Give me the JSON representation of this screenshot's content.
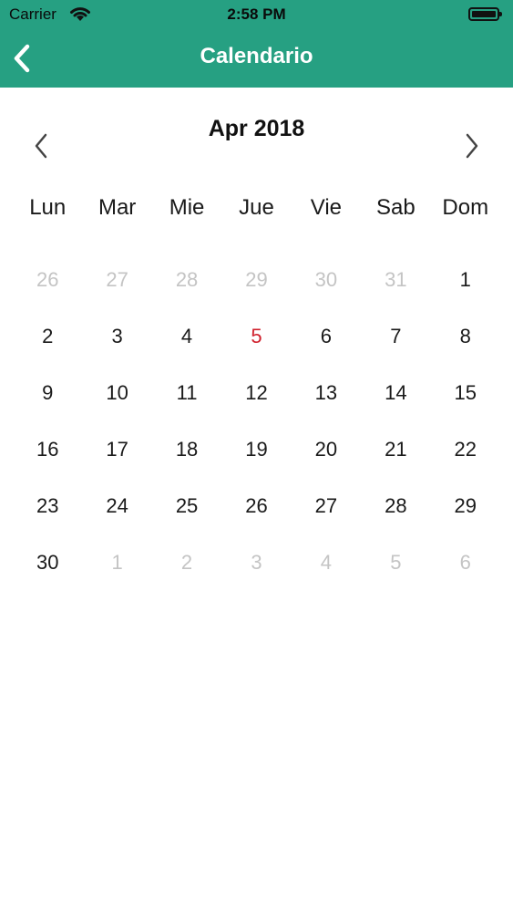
{
  "status_bar": {
    "carrier": "Carrier",
    "time": "2:58 PM"
  },
  "nav": {
    "title": "Calendario"
  },
  "calendar": {
    "month_label": "Apr 2018",
    "weekdays": [
      "Lun",
      "Mar",
      "Mie",
      "Jue",
      "Vie",
      "Sab",
      "Dom"
    ],
    "weeks": [
      [
        {
          "d": "26",
          "in": false
        },
        {
          "d": "27",
          "in": false
        },
        {
          "d": "28",
          "in": false
        },
        {
          "d": "29",
          "in": false
        },
        {
          "d": "30",
          "in": false
        },
        {
          "d": "31",
          "in": false
        },
        {
          "d": "1",
          "in": true
        }
      ],
      [
        {
          "d": "2",
          "in": true
        },
        {
          "d": "3",
          "in": true
        },
        {
          "d": "4",
          "in": true
        },
        {
          "d": "5",
          "in": true,
          "today": true
        },
        {
          "d": "6",
          "in": true
        },
        {
          "d": "7",
          "in": true
        },
        {
          "d": "8",
          "in": true
        }
      ],
      [
        {
          "d": "9",
          "in": true
        },
        {
          "d": "10",
          "in": true
        },
        {
          "d": "11",
          "in": true
        },
        {
          "d": "12",
          "in": true
        },
        {
          "d": "13",
          "in": true
        },
        {
          "d": "14",
          "in": true
        },
        {
          "d": "15",
          "in": true
        }
      ],
      [
        {
          "d": "16",
          "in": true
        },
        {
          "d": "17",
          "in": true
        },
        {
          "d": "18",
          "in": true
        },
        {
          "d": "19",
          "in": true
        },
        {
          "d": "20",
          "in": true
        },
        {
          "d": "21",
          "in": true
        },
        {
          "d": "22",
          "in": true
        }
      ],
      [
        {
          "d": "23",
          "in": true
        },
        {
          "d": "24",
          "in": true
        },
        {
          "d": "25",
          "in": true
        },
        {
          "d": "26",
          "in": true
        },
        {
          "d": "27",
          "in": true
        },
        {
          "d": "28",
          "in": true
        },
        {
          "d": "29",
          "in": true
        }
      ],
      [
        {
          "d": "30",
          "in": true
        },
        {
          "d": "1",
          "in": false
        },
        {
          "d": "2",
          "in": false
        },
        {
          "d": "3",
          "in": false
        },
        {
          "d": "4",
          "in": false
        },
        {
          "d": "5",
          "in": false
        },
        {
          "d": "6",
          "in": false
        }
      ]
    ]
  },
  "colors": {
    "header": "#26a082",
    "today": "#d0212d",
    "outside_month": "#c4c4c4"
  },
  "icons": {
    "back": "chevron-left-icon",
    "prev": "chevron-left-icon",
    "next": "chevron-right-icon"
  }
}
